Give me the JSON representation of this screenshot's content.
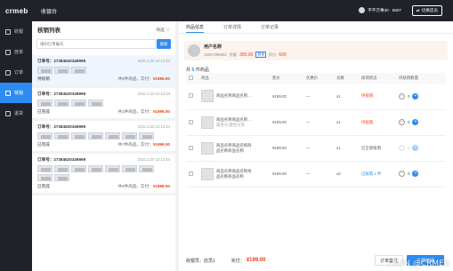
{
  "app": {
    "logo": "crmeb",
    "title": "收银台"
  },
  "topbar": {
    "user_text": "不不万事30 · 6607",
    "switch_label": "切换店员"
  },
  "sidebar": {
    "items": [
      {
        "label": "收银",
        "icon": "cashier-icon"
      },
      {
        "label": "挂单",
        "icon": "hold-order-icon"
      },
      {
        "label": "订单",
        "icon": "order-icon"
      },
      {
        "label": "核销",
        "icon": "verify-icon"
      },
      {
        "label": "退货",
        "icon": "return-icon"
      }
    ],
    "active_index": 3
  },
  "list": {
    "title": "核销列表",
    "filter_label": "筛选",
    "search_placeholder": "请扫订单编号",
    "search_button": "搜索",
    "orders": [
      {
        "no": "订单号：27384620349999",
        "time": "2021.2.20 12:13:34",
        "status": "待核销",
        "summary": "共5件商品，实付：",
        "amount": "¥1999.00",
        "thumbs": 3
      },
      {
        "no": "订单号：27384620349999",
        "time": "2021.2.20 12:13:34",
        "status": "已完成",
        "summary": "共1件商品，实付：",
        "amount": "¥1999.00",
        "thumbs": 4
      },
      {
        "no": "订单号：27384620349999",
        "time": "2021.2.20 12:13:34",
        "status": "已完成",
        "summary": "共7件商品，实付：",
        "amount": "¥1999.00",
        "thumbs": 7
      },
      {
        "no": "订单号：27384620349999",
        "time": "2021.2.20 12:13:34",
        "status": "已完成",
        "summary": "共9件商品，实付：",
        "amount": "¥1999.00",
        "thumbs": 9
      }
    ]
  },
  "tabs": [
    "商品信息",
    "订单详情",
    "订单记录"
  ],
  "customer": {
    "name": "用户名称",
    "phone": "13007296552",
    "balance_label": "余额",
    "balance": "300.00",
    "tag": "普通",
    "points_label": "积分",
    "points": "600"
  },
  "count": {
    "prefix": "共",
    "num": "5",
    "suffix": "件商品"
  },
  "table": {
    "headers": [
      "",
      "商品",
      "售价",
      "优惠价",
      "总数",
      "核销状态",
      "待核销数量"
    ],
    "rows": [
      {
        "name": "商品名称商品名称...",
        "sub": "",
        "price": "¥199.00",
        "discount": "—",
        "qty": "x1",
        "status": "待核销",
        "status_type": "red",
        "count": "0",
        "enabled": true
      },
      {
        "name": "商品名称商品名称...",
        "sub": "属性名/属性名称",
        "price": "¥199.00",
        "discount": "—",
        "qty": "x1",
        "status": "待核销",
        "status_type": "red",
        "count": "0",
        "enabled": true
      },
      {
        "name": "商品名称商品名称商品名称商品名称",
        "sub": "",
        "price": "¥199.00",
        "discount": "—",
        "qty": "x1",
        "status": "已全部核销",
        "status_type": "gray",
        "count": "0",
        "enabled": false
      },
      {
        "name": "商品名称商品名称商品名称商品名称",
        "sub": "",
        "price": "¥199.00",
        "discount": "—",
        "qty": "x2",
        "status": "已核销 1 件",
        "status_type": "blue",
        "count": "0",
        "enabled": true
      }
    ]
  },
  "footer": {
    "label": "收银员：店员1",
    "paid_label": "实付：",
    "paid": "¥199.00",
    "note_button": "订单备注",
    "confirm_button": "立即核销"
  },
  "watermark": "CSDN @CRMEB",
  "colors": {
    "accent": "#2d8cf0",
    "price": "#ed4014",
    "dark": "#1f2329"
  }
}
